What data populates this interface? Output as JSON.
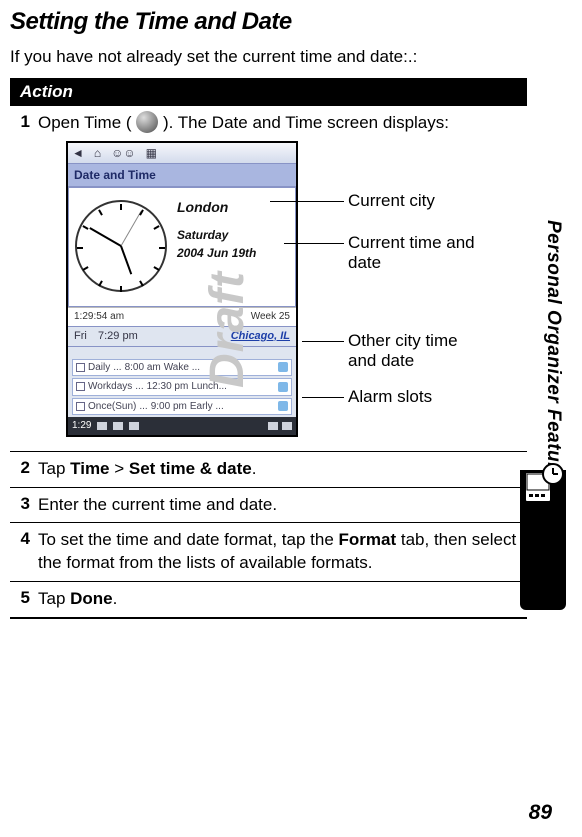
{
  "title": "Setting the Time and Date",
  "intro": "If you have not already set the current time and date:.:",
  "action_header": "Action",
  "side_label": "Personal Organizer Features",
  "watermark": "Draft",
  "page_number": "89",
  "steps": {
    "s1": {
      "num": "1",
      "pre": "Open Time ( ",
      "post": " ). The Date and Time screen displays:"
    },
    "s2": {
      "num": "2",
      "t1": "Tap ",
      "b1": "Time",
      "t2": " > ",
      "b2": " Set time  & date",
      "t3": "."
    },
    "s3": {
      "num": "3",
      "text": "Enter the current time and date."
    },
    "s4": {
      "num": "4",
      "t1": "To set the time and date format, tap the ",
      "b1": "Format",
      "t2": " tab, then select the format from the lists of available formats."
    },
    "s5": {
      "num": "5",
      "t1": "Tap ",
      "b1": "Done",
      "t2": "."
    }
  },
  "device": {
    "titlebar": "Date and Time",
    "city": "London",
    "day": "Saturday",
    "date": "2004 Jun 19th",
    "time_small": "1:29:54 am",
    "week": "Week 25",
    "other_label": "Fri",
    "other_time": "7:29 pm",
    "other_city": "Chicago, IL",
    "alarms": [
      {
        "label": "Daily",
        "dots": "...",
        "time": "8:00 am",
        "name": "Wake ..."
      },
      {
        "label": "Workdays",
        "dots": "...",
        "time": "12:30 pm",
        "name": "Lunch..."
      },
      {
        "label": "Once(Sun)",
        "dots": "...",
        "time": "9:00 pm",
        "name": "Early ..."
      }
    ],
    "status_time": "1:29"
  },
  "callouts": {
    "c1": "Current city",
    "c2a": "Current time and",
    "c2b": "date",
    "c3a": "Other city time",
    "c3b": "and date",
    "c4": "Alarm slots"
  },
  "toolbar_icons": {
    "back": "◄",
    "home": "⌂",
    "contacts": "☺☺",
    "calendar": "▦"
  }
}
